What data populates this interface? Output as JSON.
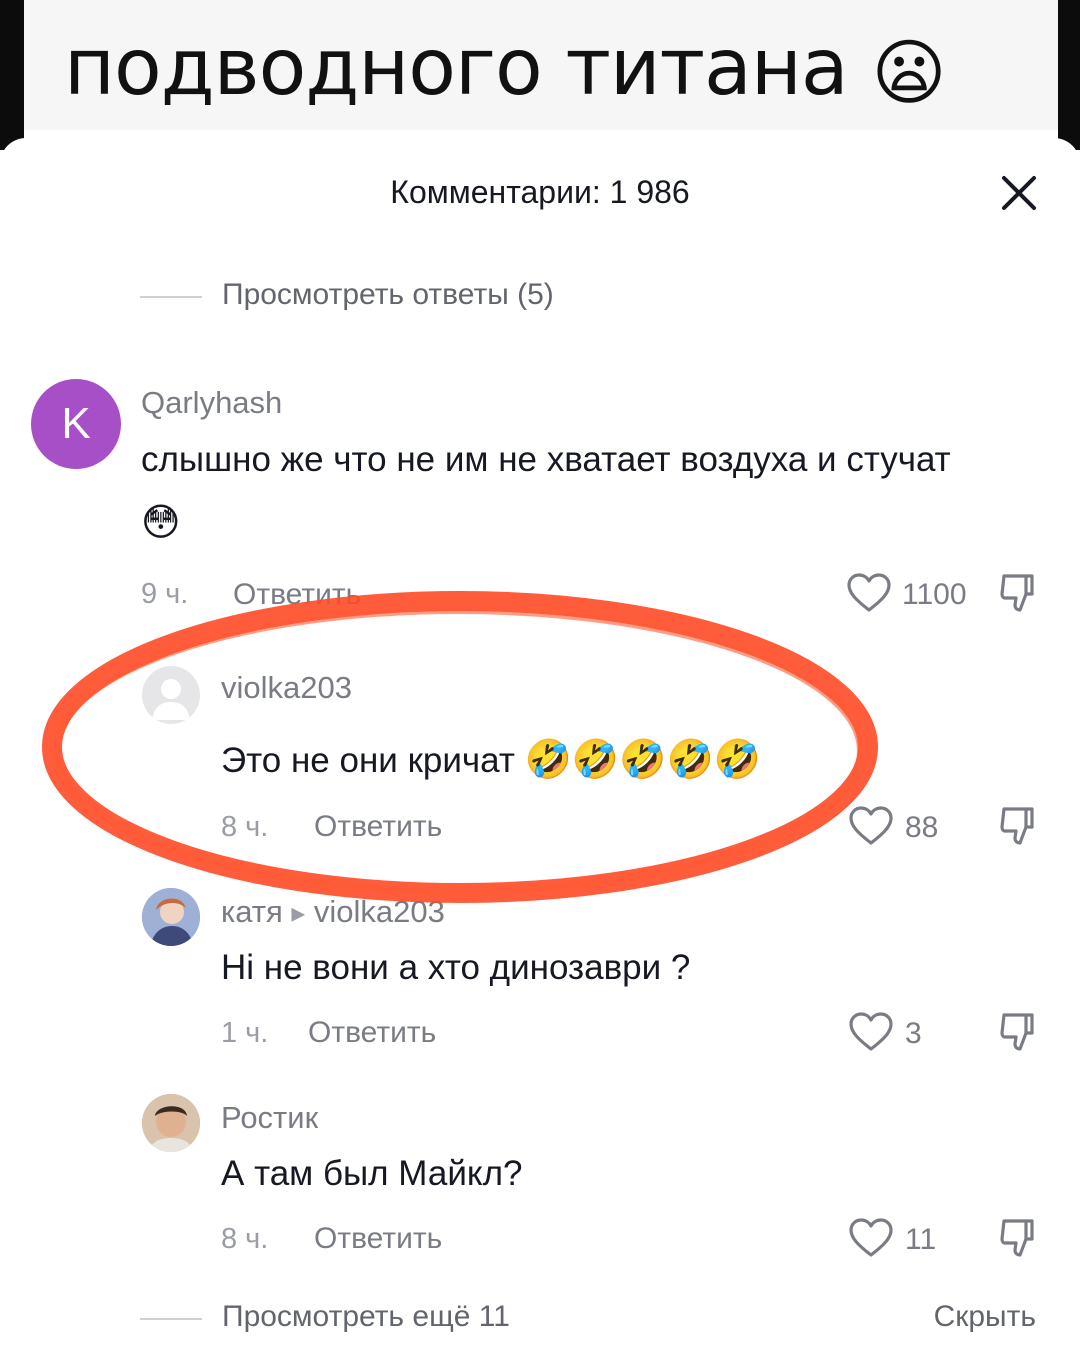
{
  "video": {
    "caption": "подводного титана",
    "caption_emoji": "😦"
  },
  "sheet": {
    "title": "Комментарии: 1 986"
  },
  "view_replies_top": "Просмотреть ответы (5)",
  "comments": [
    {
      "avatar_letter": "K",
      "avatar_color": "#a64fc6",
      "username": "Qarlyhash",
      "text_line1": "слышно же что не им не хватает воздуха и стучат",
      "text_line2": "😳",
      "time": "9 ч.",
      "reply": "Ответить",
      "likes": "1100"
    },
    {
      "username": "violka203",
      "text": "Это не они кричат",
      "emojis": "🤣🤣🤣🤣🤣",
      "time": "8 ч.",
      "reply": "Ответить",
      "likes": "88"
    },
    {
      "username": "катя",
      "reply_to": "violka203",
      "text": "Ні не вони а хто динозаври ?",
      "time": "1 ч.",
      "reply": "Ответить",
      "likes": "3"
    },
    {
      "username": "Ростик",
      "text": "А там был Майкл?",
      "time": "8 ч.",
      "reply": "Ответить",
      "likes": "11"
    }
  ],
  "footer": {
    "view_more": "Просмотреть ещё 11",
    "hide": "Скрыть"
  },
  "colors": {
    "highlight": "#ff4a26",
    "secondary_text": "#7a7c85"
  }
}
